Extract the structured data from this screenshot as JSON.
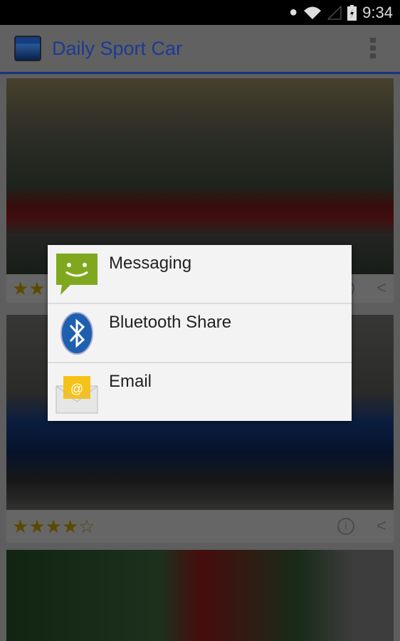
{
  "status_bar": {
    "time": "9:34",
    "icons": [
      "location-icon",
      "wifi-icon",
      "signal-icon",
      "battery-charging-icon"
    ]
  },
  "app_bar": {
    "title": "Daily Sport Car",
    "menu_icon": "overflow-menu-icon"
  },
  "cards": [
    {
      "rating": 2,
      "max": 5
    },
    {
      "rating": 4,
      "max": 5
    },
    {}
  ],
  "share_dialog": {
    "items": [
      {
        "label": "Messaging",
        "icon": "messaging-icon"
      },
      {
        "label": "Bluetooth Share",
        "icon": "bluetooth-icon"
      },
      {
        "label": "Email",
        "icon": "email-icon"
      }
    ]
  },
  "colors": {
    "accent": "#1f3e9c",
    "star": "#e0b800"
  }
}
